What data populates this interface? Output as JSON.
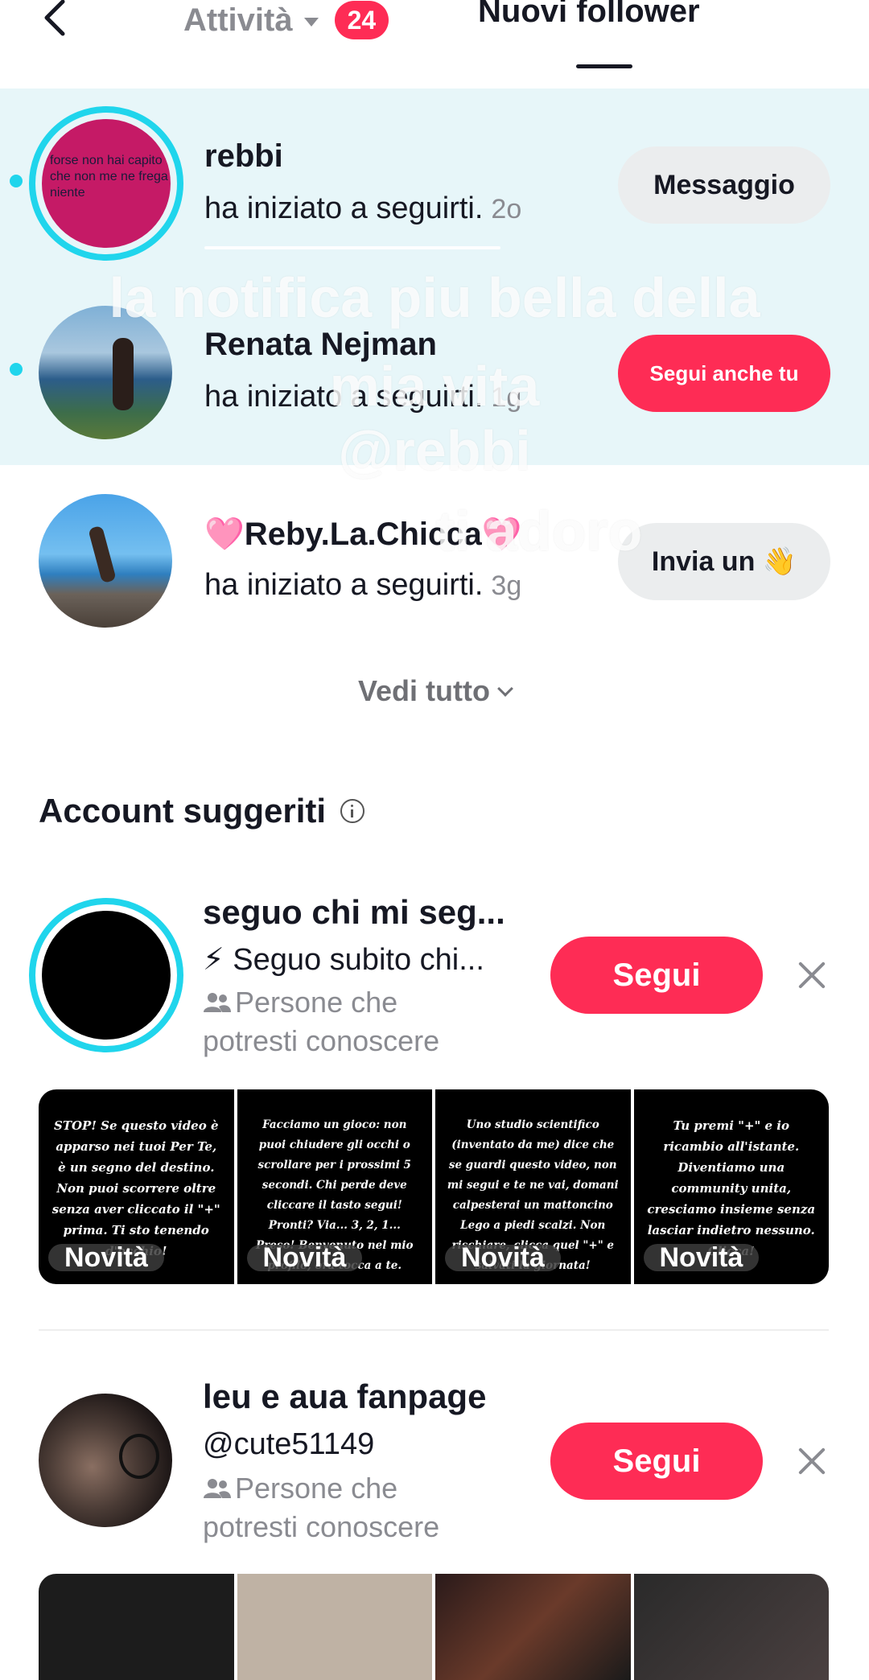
{
  "header": {
    "tab_activity": "Attività",
    "badge_count": "24",
    "tab_new_followers": "Nuovi follower"
  },
  "notifications": [
    {
      "name": "rebbi",
      "action": "ha iniziato a seguirti.",
      "time": "2o",
      "button": "Messaggio",
      "unread": true,
      "avatar_text": "forse non hai capito che non me ne frega niente"
    },
    {
      "name": "Renata Nejman",
      "action": "ha iniziato a seguirti.",
      "time": "1g",
      "button": "Segui anche tu",
      "unread": true
    },
    {
      "name": "🩷Reby.La.Chicca🩷",
      "action": "ha iniziato a seguirti.",
      "time": "3g",
      "button": "Invia un 👋",
      "unread": false
    }
  ],
  "see_all": "Vedi tutto",
  "suggested": {
    "title": "Account suggeriti",
    "accounts": [
      {
        "name": "seguo chi mi seg...",
        "subtitle": "⚡ Seguo subito chi...",
        "reason": "Persone che potresti conoscere",
        "button": "Segui",
        "videos": [
          {
            "text": "STOP! Se questo video è apparso nei tuoi Per Te, è un segno del destino. Non puoi scorrere oltre senza aver cliccato il \"+\" prima. Ti sto tenendo d'occhio!",
            "badge": "Novità"
          },
          {
            "text": "Facciamo un gioco: non puoi chiudere gli occhi o scrollare per i prossimi 5 secondi. Chi perde deve cliccare il tasto segui! Pronti? Via... 3, 2, 1... Preso! Benvenuto nel mio profilo, ora tocca a te.",
            "badge": "Novità"
          },
          {
            "text": "Uno studio scientifico (inventato da me) dice che se guardi questo video, non mi segui e te ne vai, domani calpesterai un mattoncino Lego a piedi scalzi. Non rischiare, clicca quel \"+\" e salvati la giornata!",
            "badge": "Novità"
          },
          {
            "text": "Tu premi \"+\" e io ricambio all'istante. Diventiamo una community unita, cresciamo insieme senza lasciar indietro nessuno. Clicca!",
            "badge": "Novità"
          }
        ]
      },
      {
        "name": "leu e aua fanpage",
        "subtitle": "@cute51149",
        "reason": "Persone che potresti conoscere",
        "button": "Segui"
      }
    ]
  },
  "overlay_caption": {
    "line1": "la notifica piu bella della",
    "line2": "mia vita",
    "line3": "@rebbi",
    "line4": "ti adoro"
  },
  "colors": {
    "accent_red": "#fe2c55",
    "ring_cyan": "#20d5ec",
    "unread_bg": "#e7f6f9"
  }
}
